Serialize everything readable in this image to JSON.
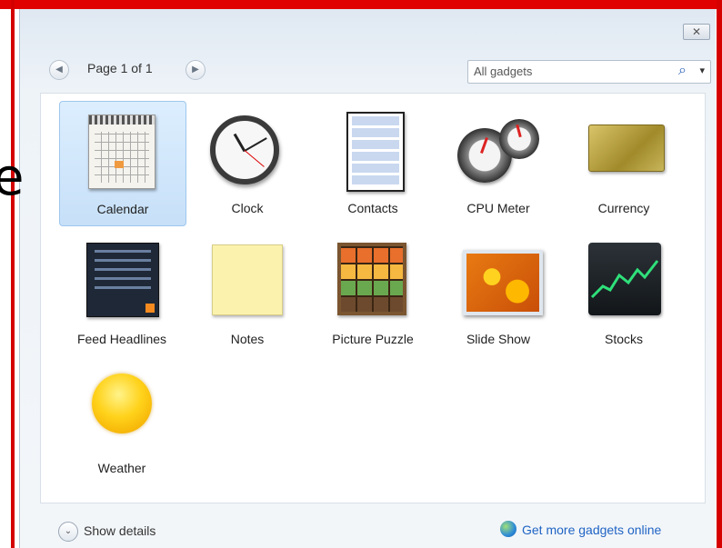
{
  "window": {
    "close_label": "✕"
  },
  "toolbar": {
    "page_label": "Page 1 of 1",
    "prev_icon": "left-arrow-icon",
    "next_icon": "right-arrow-icon",
    "search_value": "All gadgets",
    "search_icon": "⌕",
    "search_dropdown": "▾"
  },
  "gadgets": [
    {
      "label": "Calendar"
    },
    {
      "label": "Clock"
    },
    {
      "label": "Contacts"
    },
    {
      "label": "CPU Meter"
    },
    {
      "label": "Currency"
    },
    {
      "label": "Feed Headlines"
    },
    {
      "label": "Notes"
    },
    {
      "label": "Picture Puzzle"
    },
    {
      "label": "Slide Show"
    },
    {
      "label": "Stocks"
    },
    {
      "label": "Weather"
    }
  ],
  "footer": {
    "details_label": "Show details",
    "details_icon": "⌄",
    "online_label": "Get more gadgets online"
  },
  "stray_text": "e"
}
